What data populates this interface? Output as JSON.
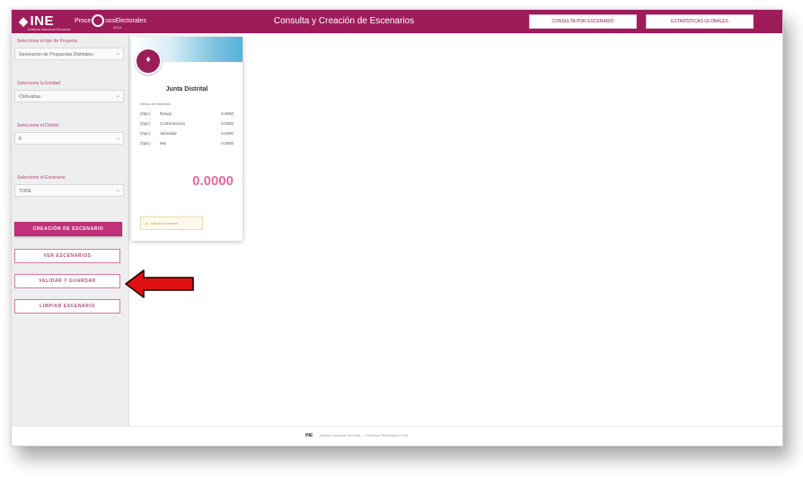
{
  "header": {
    "logo": "INE",
    "logo_mark": "◆",
    "logo_sub": "Instituto Nacional Electoral",
    "process_logo_left": "Proce",
    "process_logo_right": "sosElectorales",
    "process_year": "2018",
    "title": "Consulta y Creación de Escenarios",
    "btn_1": "CONSULTA POR ESCENARIO",
    "btn_2": "ESTADÍSTICAS GLOBALES"
  },
  "sidebar": {
    "label_1": "Seleccione el tipo de Proyecto",
    "select_1": "Generación de Propuestas Distritales",
    "label_2": "Seleccione la Entidad",
    "select_2": "Chihuahua",
    "label_3": "Seleccione el Distrito",
    "select_3": "8",
    "label_4": "Seleccione el Escenario",
    "select_4": "TODE",
    "chevron": "⌄",
    "btn_creacion": "CREACIÓN DE ESCENARIO",
    "btn_ver": "VER ESCENARIOS",
    "btn_validar": "VALIDAR Y GUARDAR",
    "btn_limpiar": "LIMPIAR ESCENARIO"
  },
  "card": {
    "avatar_icon": "map-pin-icon",
    "avatar_glyph": "♦",
    "title": "Junta Distrital",
    "subtitle": "Métrica del escenario",
    "metrics": [
      {
        "code": "(Opt.)",
        "name": "Rango",
        "value": "0.0000"
      },
      {
        "code": "(Opt.)",
        "name": "Conformación",
        "value": "0.0000"
      },
      {
        "code": "(Opt.)",
        "name": "Vecindad",
        "value": "0.0000"
      },
      {
        "code": "(Opt.)",
        "name": "Mix",
        "value": "0.0000"
      }
    ],
    "score": "0.0000",
    "warning_icon": "warning-icon",
    "warning_glyph": "▲",
    "warning_text": "Validar escenario"
  },
  "footer": {
    "logo": "INE",
    "text": "Instituto Nacional Electoral — Derechos Reservados 2018"
  },
  "colors": {
    "brand": "#9f1c5b",
    "accent": "#c2307a",
    "score": "#e96a9e",
    "annotation_arrow": "#e01010"
  }
}
